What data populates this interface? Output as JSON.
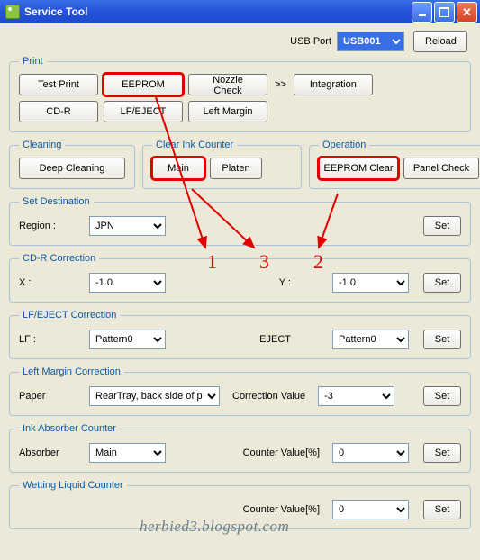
{
  "title": "Service Tool",
  "usbPort": {
    "label": "USB Port",
    "value": "USB001"
  },
  "reload": "Reload",
  "print": {
    "legend": "Print",
    "testPrint": "Test Print",
    "eeprom": "EEPROM",
    "nozzleCheck": "Nozzle Check",
    "integration": "Integration",
    "cdr": "CD-R",
    "lfeject": "LF/EJECT",
    "leftMargin": "Left Margin"
  },
  "cleaning": {
    "legend": "Cleaning",
    "deep": "Deep Cleaning"
  },
  "clearInk": {
    "legend": "Clear Ink Counter",
    "main": "Main",
    "platen": "Platen"
  },
  "operation": {
    "legend": "Operation",
    "eepromClear": "EEPROM Clear",
    "panelCheck": "Panel Check"
  },
  "setDest": {
    "legend": "Set Destination",
    "regionLabel": "Region :",
    "region": "JPN",
    "set": "Set"
  },
  "cdrCorr": {
    "legend": "CD-R Correction",
    "xLabel": "X :",
    "x": "-1.0",
    "yLabel": "Y :",
    "y": "-1.0",
    "set": "Set"
  },
  "lfCorr": {
    "legend": "LF/EJECT Correction",
    "lfLabel": "LF :",
    "lf": "Pattern0",
    "ejectLabel": "EJECT",
    "eject": "Pattern0",
    "set": "Set"
  },
  "leftMarginCorr": {
    "legend": "Left Margin Correction",
    "paperLabel": "Paper",
    "paper": "RearTray, back side of p",
    "corrLabel": "Correction Value",
    "corr": "-3",
    "set": "Set"
  },
  "inkAbs": {
    "legend": "Ink Absorber Counter",
    "absorberLabel": "Absorber",
    "absorber": "Main",
    "counterLabel": "Counter Value[%]",
    "counter": "0",
    "set": "Set"
  },
  "wetting": {
    "legend": "Wetting Liquid Counter",
    "counterLabel": "Counter Value[%]",
    "counter": "0",
    "set": "Set"
  },
  "annotations": {
    "a1": "1",
    "a2": "2",
    "a3": "3"
  },
  "watermark": "herbied3.blogspot.com",
  "colors": {
    "highlight": "#e00000"
  }
}
